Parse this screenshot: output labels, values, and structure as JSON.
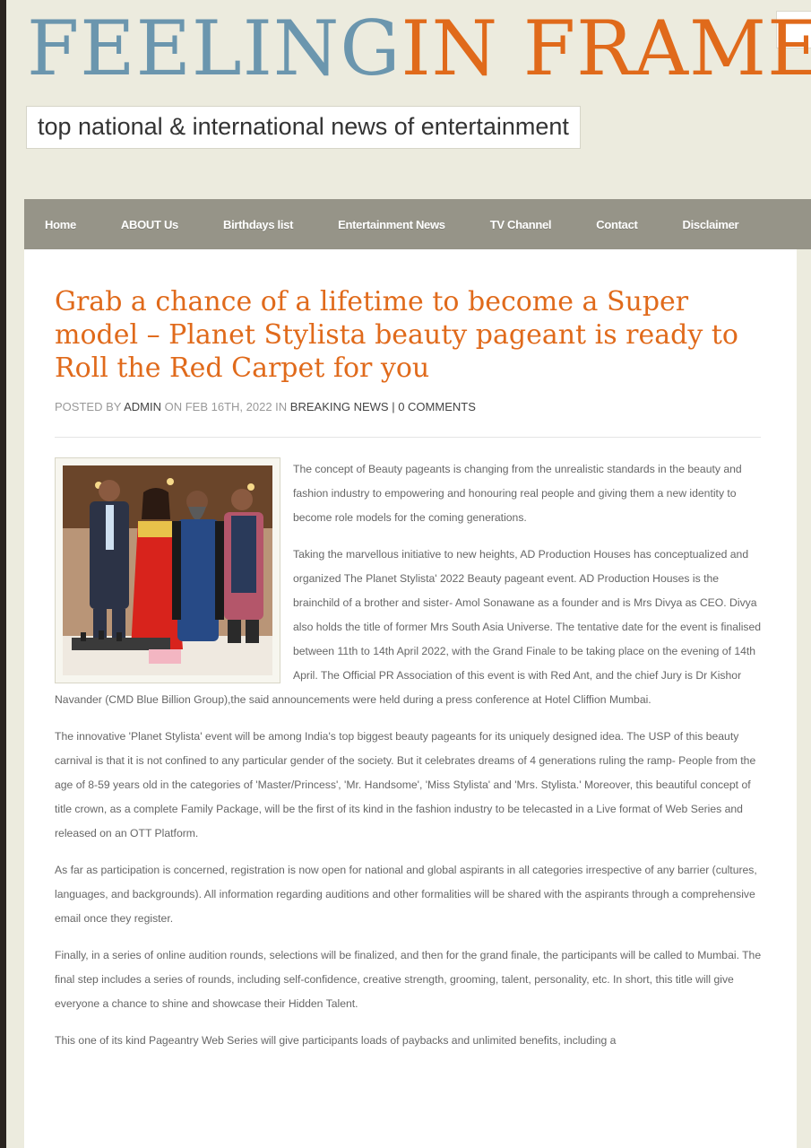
{
  "site": {
    "title_part1": "FEELING",
    "title_part2": "IN FRAME",
    "tagline": "top national & international news of entertainment"
  },
  "nav": {
    "items": [
      "Home",
      "ABOUT Us",
      "Birthdays list",
      "Entertainment News",
      "TV Channel",
      "Contact",
      "Disclaimer"
    ]
  },
  "post": {
    "title": "Grab a chance of a lifetime to become a Super model – Planet Stylista beauty pageant is ready to Roll the Red Carpet for you",
    "meta": {
      "posted_by": "POSTED BY",
      "author": "ADMIN",
      "on": "ON FEB 16TH, 2022 IN",
      "category": "BREAKING NEWS",
      "sep": " | ",
      "comments": "0 COMMENTS"
    },
    "paragraphs": [
      "The concept of Beauty pageants is changing from the unrealistic standards in the beauty and fashion industry to empowering and honouring real people and giving them a new identity to become role models for the coming generations.",
      "Taking the marvellous initiative to new heights, AD Production Houses has conceptualized and organized The Planet Stylista' 2022 Beauty pageant event. AD Production Houses is the brainchild of a brother and sister- Amol Sonawane as a founder and is Mrs Divya as CEO. Divya also holds the title of former Mrs South Asia Universe. The tentative date for the event is finalised between 11th to 14th April 2022, with the Grand Finale to be taking place on the evening of 14th April. The Official PR Association of this event is with Red Ant, and the chief Jury is Dr Kishor Navander (CMD Blue Billion Group),the said announcements were held during a press conference at Hotel Cliffion Mumbai.",
      "The innovative 'Planet Stylista' event will be among India's top biggest beauty pageants for its uniquely designed idea. The USP of this beauty carnival is that it is not confined to any particular gender of the society. But it celebrates dreams of 4 generations ruling the ramp- People from the age of 8-59 years old in the categories of 'Master/Princess', 'Mr. Handsome', 'Miss Stylista' and 'Mrs. Stylista.' Moreover, this beautiful concept of title crown, as a complete Family Package, will be the first of its kind in the fashion industry to be telecasted in a Live format of Web Series and released on an OTT Platform.",
      "As far as participation is concerned, registration is now open for national and global aspirants in all categories irrespective of any barrier (cultures, languages, and backgrounds). All information regarding auditions and other formalities will be shared with the aspirants through a comprehensive email once they register.",
      "Finally, in a series of online audition rounds, selections will be finalized, and then for the grand finale, the participants will be called to Mumbai. The final step includes a series of rounds, including self-confidence, creative strength, grooming, talent, personality, etc. In short, this title will give everyone a chance to shine and showcase their Hidden Talent.",
      "This one of its kind Pageantry Web Series will give participants loads of paybacks and unlimited benefits, including a"
    ]
  },
  "colors": {
    "title_blue": "#6b96ae",
    "accent_orange": "#e06a1b",
    "nav_bg": "#969488",
    "page_bg": "#ecebde"
  }
}
